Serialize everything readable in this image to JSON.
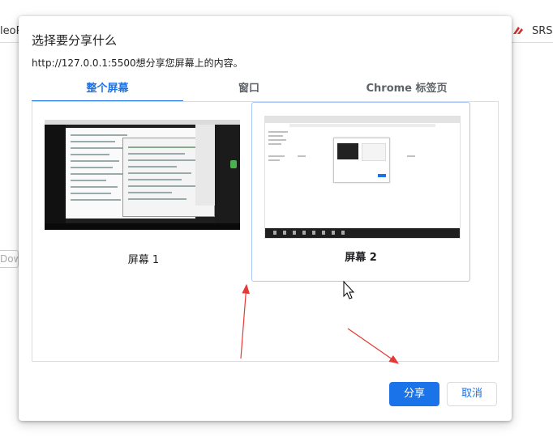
{
  "background": {
    "left_text": "leoR",
    "right_text": "SRS",
    "down_button": "Dow"
  },
  "dialog": {
    "title": "选择要分享什么",
    "subtitle": "http://127.0.0.1:5500想分享您屏幕上的内容。",
    "tabs": [
      {
        "label": "整个屏幕",
        "active": true
      },
      {
        "label": "窗口",
        "active": false
      },
      {
        "label": "Chrome 标签页",
        "active": false
      }
    ],
    "screens": [
      {
        "label": "屏幕 1",
        "selected": false
      },
      {
        "label": "屏幕 2",
        "selected": true
      }
    ],
    "share_label": "分享",
    "cancel_label": "取消"
  },
  "colors": {
    "accent": "#1a73e8",
    "annotation": "#e53935",
    "selected_border": "#a8c7fa"
  }
}
